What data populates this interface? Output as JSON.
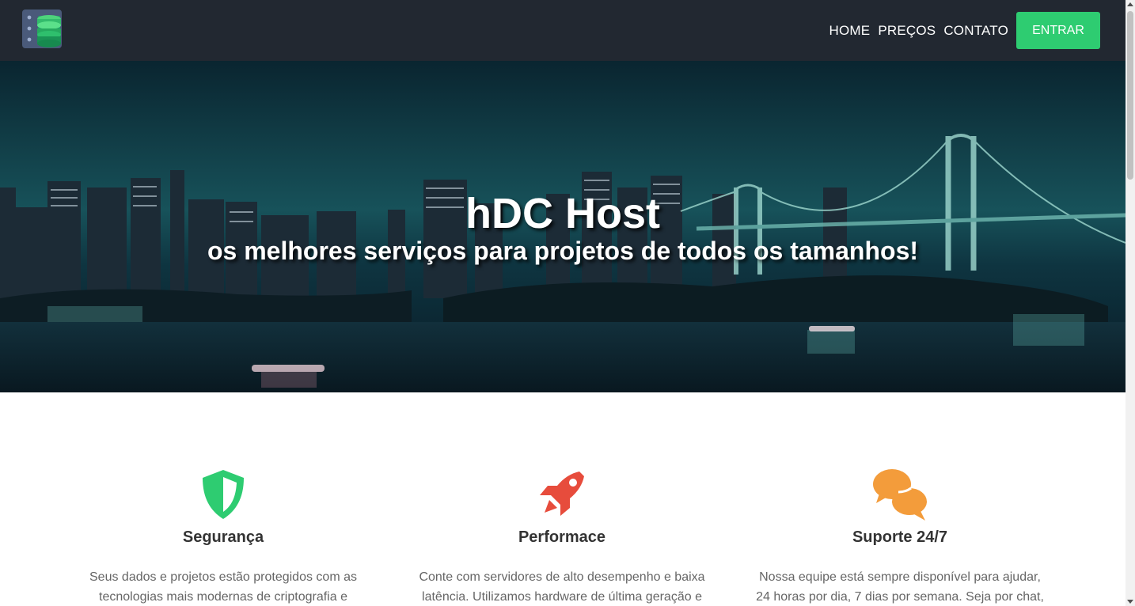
{
  "nav": {
    "items": [
      "HOME",
      "PREÇOS",
      "CONTATO"
    ],
    "login_button": "ENTRAR",
    "accent": "#2ecc71",
    "background": "#222831"
  },
  "hero": {
    "title": "hDC Host",
    "subtitle": "os melhores serviços para projetos de todos os tamanhos!"
  },
  "features": [
    {
      "icon": "shield-icon",
      "color": "#2ecc71",
      "title": "Segurança",
      "text": "Seus dados e projetos estão protegidos com as tecnologias mais modernas de criptografia e"
    },
    {
      "icon": "rocket-icon",
      "color": "#e74c3c",
      "title": "Performace",
      "text": "Conte com servidores de alto desempenho e baixa latência. Utilizamos hardware de última geração e"
    },
    {
      "icon": "chat-bubbles-icon",
      "color": "#f39c3b",
      "title": "Suporte 24/7",
      "text": "Nossa equipe está sempre disponível para ajudar, 24 horas por dia, 7 dias por semana. Seja por chat, e-"
    }
  ]
}
